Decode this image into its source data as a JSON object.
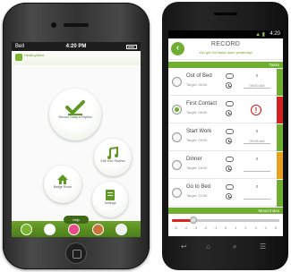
{
  "iphone": {
    "status": {
      "carrier": "Bell",
      "time": "4:20 PM"
    },
    "brand": {
      "logo_text": "HealthyMind"
    },
    "menu": {
      "record_label": "Record Today's Rhythm",
      "list_label": "Edit Your Rhythm",
      "badge_label": "Badge Room",
      "settings_label": "Settings"
    },
    "help_label": "help",
    "dock": [
      {
        "label": "",
        "color": "#7ab530"
      },
      {
        "label": "",
        "color": "#ffffff"
      },
      {
        "label": "",
        "color": "#e84a8a"
      },
      {
        "label": "",
        "color": "#c9723a"
      },
      {
        "label": "",
        "color": "#f0f0f0"
      }
    ]
  },
  "android": {
    "status": {
      "time": "4:20"
    },
    "header": {
      "title": "RECORD",
      "subtitle": "You got 0/4 tasks done yesterday!"
    },
    "tasks_label": "Tasks",
    "tasks": [
      {
        "name": "Out of Bed",
        "target": "Target: 06:00",
        "count": "0",
        "time": "08:00 AM",
        "alert": false,
        "checked": false,
        "band": "#6fae2e"
      },
      {
        "name": "First Contact",
        "target": "Target: 08:00",
        "count": "",
        "time": "",
        "alert": true,
        "checked": true,
        "band": "#d22222"
      },
      {
        "name": "Start Work",
        "target": "Target: 09:00",
        "count": "0",
        "time": "09:08 AM",
        "alert": false,
        "checked": false,
        "band": "#6fae2e"
      },
      {
        "name": "Dinner",
        "target": "Target: 18:00",
        "count": "0",
        "time": "",
        "alert": false,
        "checked": false,
        "band": "#e8a020"
      },
      {
        "name": "Go to Bed",
        "target": "Target: 22:00",
        "count": "0",
        "time": "",
        "alert": false,
        "checked": false,
        "band": "#6fae2e"
      }
    ],
    "mood_label": "Mood Index",
    "mood": {
      "min": -5,
      "max": 5,
      "value": -3
    },
    "scale": [
      "-5",
      "-4",
      "-3",
      "-2",
      "-1",
      "0",
      "1",
      "2",
      "3",
      "4",
      "5"
    ]
  },
  "colors": {
    "accent": "#6fae2e",
    "alert": "#d22222",
    "warn": "#e8a020"
  }
}
